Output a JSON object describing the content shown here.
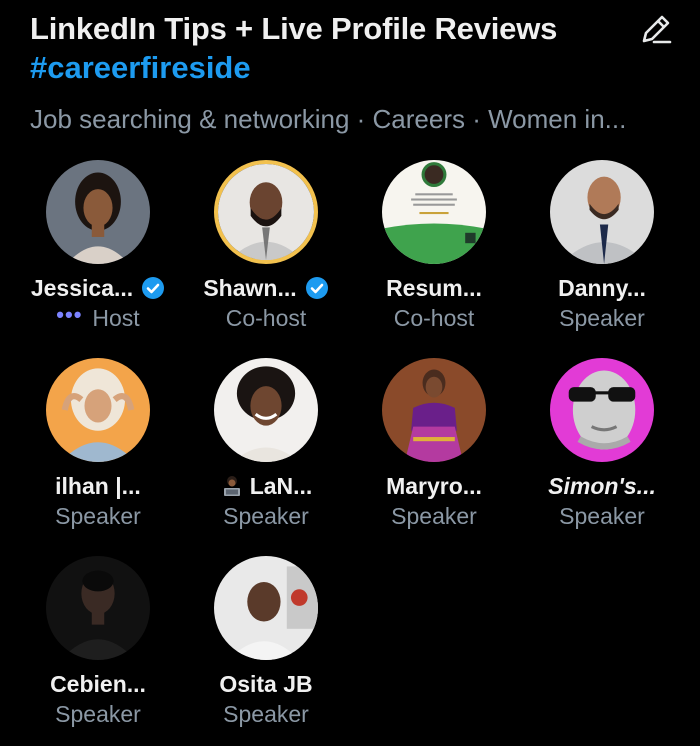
{
  "header": {
    "title": "LinkedIn Tips + Live Profile Reviews",
    "hashtag": "#careerfireside",
    "topics": "Job searching & networking · Careers · Women in..."
  },
  "colors": {
    "background": "#000000",
    "accent": "#1d9bf0",
    "muted": "#8b98a5",
    "host_dots": "#7c83ff",
    "cohost_ring": "#f2c14e"
  },
  "participants": [
    {
      "name": "Jessica...",
      "role": "Host",
      "verified": true
    },
    {
      "name": "Shawn...",
      "role": "Co-host",
      "verified": true
    },
    {
      "name": "Resum...",
      "role": "Co-host",
      "verified": false
    },
    {
      "name": "Danny...",
      "role": "Speaker",
      "verified": false
    },
    {
      "name": "ilhan |...",
      "role": "Speaker",
      "verified": false
    },
    {
      "name": "LaN...",
      "role": "Speaker",
      "verified": false,
      "prefix_icon": "laptop-person-emoji"
    },
    {
      "name": "Maryro...",
      "role": "Speaker",
      "verified": false
    },
    {
      "name": "Simon's...",
      "role": "Speaker",
      "verified": false
    },
    {
      "name": "Cebien...",
      "role": "Speaker",
      "verified": false
    },
    {
      "name": "Osita JB",
      "role": "Speaker",
      "verified": false
    }
  ],
  "icons": {
    "edit": "pencil-edit-icon",
    "verified": "verified-badge-icon",
    "host": "speaking-dots-icon"
  }
}
